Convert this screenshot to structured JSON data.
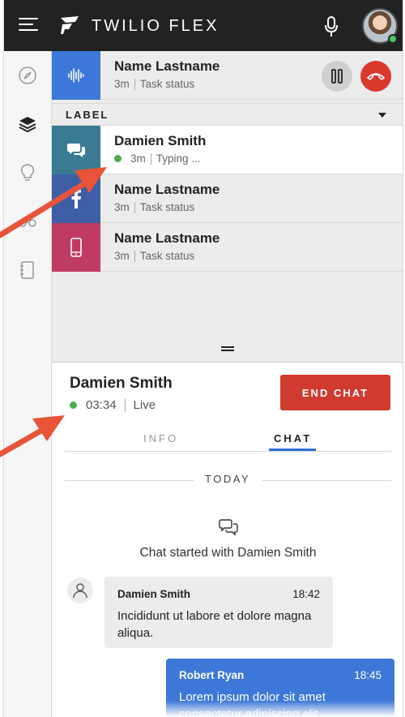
{
  "header": {
    "brand": "TWILIO FLEX"
  },
  "sidebar": {
    "items": [
      {
        "icon": "compass-icon"
      },
      {
        "icon": "layers-icon"
      },
      {
        "icon": "lightbulb-icon"
      },
      {
        "icon": "glasses-icon"
      },
      {
        "icon": "notebook-icon"
      }
    ]
  },
  "active_call": {
    "name": "Name Lastname",
    "time": "3m",
    "status": "Task status",
    "tile_color": "#3d78d8"
  },
  "label_group": {
    "label": "LABEL"
  },
  "tasks": [
    {
      "name": "Damien Smith",
      "time": "3m",
      "status": "Typing ...",
      "tile_color": "#3b7a93",
      "icon": "chat-bubbles-icon",
      "selected": true
    },
    {
      "name": "Name Lastname",
      "time": "3m",
      "status": "Task status",
      "tile_color": "#3e5fa6",
      "icon": "facebook-icon",
      "selected": false
    },
    {
      "name": "Name Lastname",
      "time": "3m",
      "status": "Task status",
      "tile_color": "#c03b63",
      "icon": "phone-icon",
      "selected": false
    }
  ],
  "chat": {
    "customer_name": "Damien Smith",
    "duration": "03:34",
    "state": "Live",
    "end_label": "END CHAT",
    "tabs": [
      {
        "label": "INFO",
        "active": false
      },
      {
        "label": "CHAT",
        "active": true
      }
    ],
    "day_divider": "TODAY",
    "started_text": "Chat started with Damien Smith",
    "messages": [
      {
        "author": "Damien Smith",
        "time": "18:42",
        "text": "Incididunt ut labore et dolore magna aliqua.",
        "direction": "in"
      },
      {
        "author": "Robert Ryan",
        "time": "18:45",
        "text": "Lorem ipsum dolor sit amet consectetur adipiscing elit",
        "direction": "out"
      }
    ]
  },
  "colors": {
    "header_bg": "#222222",
    "accent_blue": "#2f6fd4",
    "end_chat_red": "#d13b2f",
    "presence_green": "#4cae4c",
    "annotation_arrow": "#e8533a"
  }
}
